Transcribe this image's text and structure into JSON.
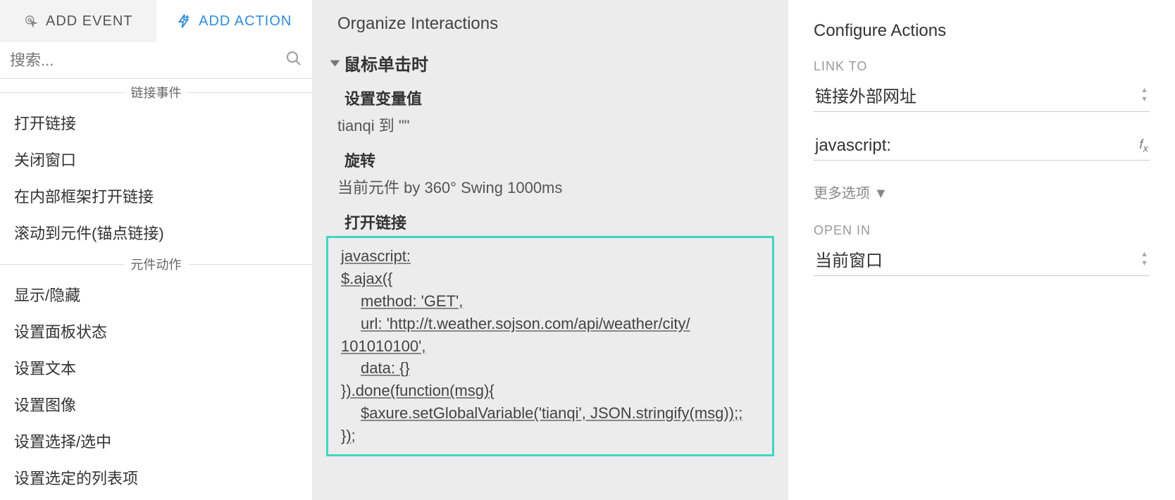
{
  "tabs": {
    "addEvent": "ADD EVENT",
    "addAction": "ADD ACTION"
  },
  "search": {
    "placeholder": "搜索..."
  },
  "sections": {
    "linkEvents": {
      "title": "链接事件",
      "items": [
        "打开链接",
        "关闭窗口",
        "在内部框架打开链接",
        "滚动到元件(锚点链接)"
      ]
    },
    "widgetActions": {
      "title": "元件动作",
      "items": [
        "显示/隐藏",
        "设置面板状态",
        "设置文本",
        "设置图像",
        "设置选择/选中",
        "设置选定的列表项"
      ]
    }
  },
  "mid": {
    "title": "Organize Interactions",
    "eventName": "鼠标单击时",
    "actions": {
      "setVar": {
        "label": "设置变量值",
        "desc": "tianqi 到 \"\""
      },
      "rotate": {
        "label": "旋转",
        "desc": "当前元件 by 360° Swing 1000ms"
      },
      "openLink": {
        "label": "打开链接",
        "code": {
          "l0": "javascript:",
          "l1": "$.ajax({",
          "l2": "method: 'GET',",
          "l3": "url: 'http://t.weather.sojson.com/api/weather/city/",
          "l4": "101010100',",
          "l5": "data: {}",
          "l6": "}).done(function(msg){",
          "l7": "$axure.setGlobalVariable('tianqi', JSON.stringify(msg));",
          "l8": "});"
        }
      }
    }
  },
  "right": {
    "title": "Configure Actions",
    "linkToLabel": "LINK TO",
    "linkToValue": "链接外部网址",
    "urlValue": "javascript:",
    "moreOptions": "更多选项 ▼",
    "openInLabel": "OPEN IN",
    "openInValue": "当前窗口"
  }
}
